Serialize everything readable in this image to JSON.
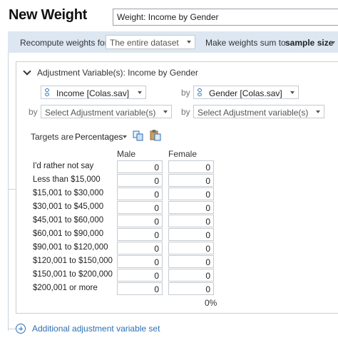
{
  "header": {
    "title": "New Weight",
    "name_value": "Weight: Income by Gender"
  },
  "options_bar": {
    "recompute_label": "Recompute weights for",
    "recompute_value": "The entire dataset",
    "sum_label": "Make weights sum to",
    "sum_value": "sample size"
  },
  "adjustment_set": {
    "heading": "Adjustment Variable(s): Income by Gender",
    "var1": "Income [Colas.sav]",
    "by_label": "by",
    "var2": "Gender [Colas.sav]",
    "placeholder": "Select Adjustment variable(s)",
    "targets_label": "Targets are",
    "targets_value": "Percentages",
    "columns": [
      "Male",
      "Female"
    ],
    "rows": [
      {
        "label": "I'd rather not say",
        "male": "0",
        "female": "0"
      },
      {
        "label": "Less than $15,000",
        "male": "0",
        "female": "0"
      },
      {
        "label": "$15,001 to $30,000",
        "male": "0",
        "female": "0"
      },
      {
        "label": "$30,001 to $45,000",
        "male": "0",
        "female": "0"
      },
      {
        "label": "$45,001 to $60,000",
        "male": "0",
        "female": "0"
      },
      {
        "label": "$60,001 to $90,000",
        "male": "0",
        "female": "0"
      },
      {
        "label": "$90,001 to $120,000",
        "male": "0",
        "female": "0"
      },
      {
        "label": "$120,001 to $150,000",
        "male": "0",
        "female": "0"
      },
      {
        "label": "$150,001 to $200,000",
        "male": "0",
        "female": "0"
      },
      {
        "label": "$200,001 or more",
        "male": "0",
        "female": "0"
      }
    ],
    "total": "0%"
  },
  "footer": {
    "add_label": "Additional adjustment variable set"
  }
}
